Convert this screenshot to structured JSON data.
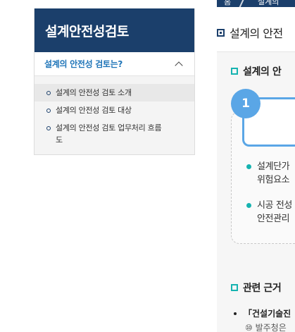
{
  "sidebar": {
    "title": "설계안전성검토",
    "submenu_title": "설계의 안전성 검토는?",
    "items": [
      {
        "label": "설계의 안전성 검토 소개"
      },
      {
        "label": "설계의 안전성 검토 대상"
      },
      {
        "label": "설계의 안전성 검토 업무처리 흐름도"
      }
    ]
  },
  "breadcrumb": {
    "home": "홈",
    "current": "설계의"
  },
  "main": {
    "page_title": "설계의 안전",
    "section1_heading": "설계의 안",
    "step_number": "1",
    "bullets": [
      {
        "line1": "설계단가",
        "line2": "위험요소"
      },
      {
        "line1": "시공 전성",
        "line2": "안전관리"
      }
    ],
    "section2_heading": "관련 근거",
    "law_label": "「건설기술진",
    "law_sub": "⑩ 발주청은"
  }
}
